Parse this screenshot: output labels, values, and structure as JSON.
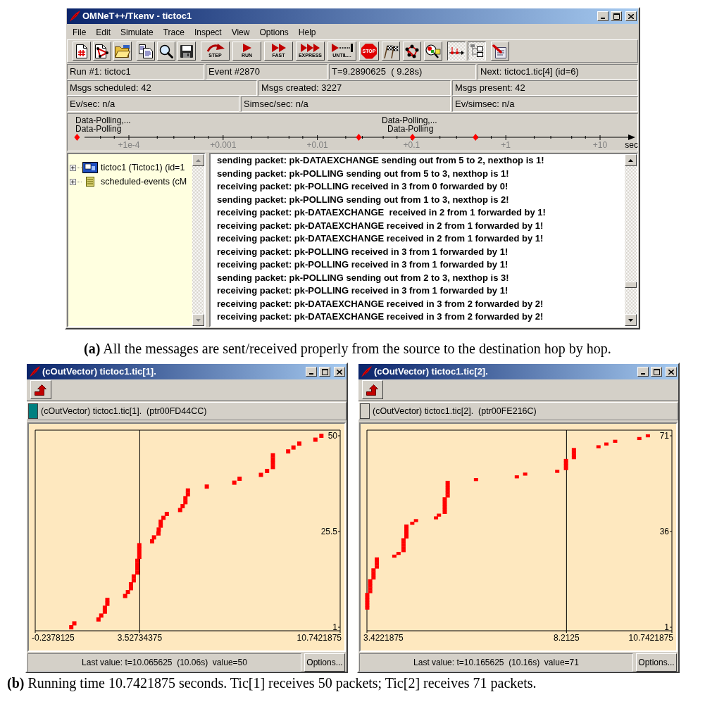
{
  "main_window": {
    "title": "OMNeT++/Tkenv - tictoc1",
    "menu": [
      "File",
      "Edit",
      "Simulate",
      "Trace",
      "Inspect",
      "View",
      "Options",
      "Help"
    ],
    "toolbar": [
      [
        {
          "kind": "new",
          "pressed": false
        },
        {
          "kind": "load",
          "pressed": false
        },
        {
          "kind": "open",
          "pressed": false
        }
      ],
      [
        {
          "kind": "copy",
          "pressed": false
        },
        {
          "kind": "find",
          "pressed": false
        },
        {
          "kind": "save",
          "pressed": false
        }
      ],
      [
        {
          "kind": "step",
          "label": "STEP",
          "pressed": false
        },
        {
          "kind": "run",
          "label": "RUN",
          "pressed": false
        },
        {
          "kind": "fast",
          "label": "FAST",
          "pressed": false
        },
        {
          "kind": "express",
          "label": "EXPRESS",
          "pressed": false
        },
        {
          "kind": "until",
          "label": "UNTIL...",
          "pressed": false
        },
        {
          "kind": "stop",
          "label": "STOP",
          "pressed": false
        },
        {
          "kind": "finish",
          "pressed": false
        },
        {
          "kind": "network",
          "pressed": false
        },
        {
          "kind": "inspect",
          "pressed": false
        }
      ],
      [
        {
          "kind": "timeline",
          "pressed": true
        },
        {
          "kind": "tree",
          "pressed": true
        }
      ],
      [
        {
          "kind": "options",
          "pressed": false
        }
      ]
    ],
    "status_rows": [
      [
        "Run #1: tictoc1",
        "Event #2870",
        "T=9.2890625  ( 9.28s)",
        "Next: tictoc1.tic[4] (id=6)"
      ],
      [
        "Msgs scheduled: 42",
        "Msgs created: 3227",
        "Msgs present: 42"
      ],
      [
        "Ev/sec: n/a",
        "Simsec/sec: n/a",
        "Ev/simsec: n/a"
      ]
    ],
    "timeline": {
      "labels": [
        "Data-Polling,...",
        "Data-Polling",
        "Data-Polling,...",
        "Data-Polling"
      ],
      "ticks": [
        "+1e-4",
        "+0.001",
        "+0.01",
        "+0.1",
        "+1",
        "+10"
      ],
      "unit": "sec"
    },
    "object_tree": [
      {
        "kind": "module",
        "label": "tictoc1 (Tictoc1) (id=1",
        "expanded": false
      },
      {
        "kind": "queue",
        "label": "scheduled-events (cM",
        "expanded": false
      }
    ],
    "log": [
      "sending packet: pk-DATAEXCHANGE sending out from 5 to 2, nexthop is 1!",
      "sending packet: pk-POLLING sending out from 5 to 3, nexthop is 1!",
      "receiving packet: pk-POLLING received in 3 from 0 forwarded by 0!",
      "sending packet: pk-POLLING sending out from 1 to 3, nexthop is 2!",
      "receiving packet: pk-DATAEXCHANGE  received in 2 from 1 forwarded by 1!",
      "receiving packet: pk-DATAEXCHANGE received in 2 from 1 forwarded by 1!",
      "receiving packet: pk-DATAEXCHANGE received in 2 from 1 forwarded by 1!",
      "receiving packet: pk-POLLING received in 3 from 1 forwarded by 1!",
      "receiving packet: pk-POLLING received in 3 from 1 forwarded by 1!",
      "sending packet: pk-POLLING sending out from 2 to 3, nexthop is 3!",
      "receiving packet: pk-POLLING received in 3 from 1 forwarded by 1!",
      "receiving packet: pk-DATAEXCHANGE received in 3 from 2 forwarded by 2!",
      "receiving packet: pk-DATAEXCHANGE received in 3 from 2 forwarded by 2!"
    ]
  },
  "caption_a": "**(a)** All the messages are sent/received properly from the source to the destination hop by hop.",
  "vector_windows": [
    {
      "title": "(cOutVector) tictoc1.tic[1].",
      "color": "#008080",
      "info": "(cOutVector) tictoc1.tic[1].  (ptr00FD44CC)",
      "chart_data": {
        "type": "scatter",
        "xlim": [
          -0.2378125,
          10.7421875
        ],
        "ylim": [
          0.1,
          51.44
        ],
        "xticks": [
          -0.2378125,
          3.52734375,
          10.7421875
        ],
        "yticks": [
          1,
          25.5,
          50
        ],
        "x": [
          1.06,
          1.17,
          2.04,
          2.14,
          2.27,
          2.27,
          2.36,
          2.36,
          3.0,
          3.1,
          3.21,
          3.21,
          3.31,
          3.31,
          3.44,
          3.44,
          3.44,
          3.44,
          3.51,
          3.51,
          3.51,
          3.51,
          3.97,
          4.04,
          4.2,
          4.21,
          4.28,
          4.28,
          4.38,
          4.5,
          4.98,
          5.07,
          5.17,
          5.17,
          5.26,
          5.26,
          5.94,
          6.93,
          7.12,
          7.89,
          8.11,
          8.32,
          8.32,
          8.32,
          8.32,
          8.87,
          9.06,
          9.27,
          9.85,
          10.065625
        ],
        "series": [
          {
            "color": "#ff0000",
            "values": [
              1,
              2,
              3,
              4,
              5,
              6,
              7,
              8,
              9,
              10,
              11,
              12,
              13,
              14,
              15,
              16,
              17,
              18,
              19,
              20,
              21,
              22,
              23,
              24,
              25,
              26,
              27,
              28,
              29,
              30,
              31,
              32,
              33,
              34,
              35,
              36,
              37,
              38,
              39,
              40,
              41,
              42,
              43,
              44,
              45,
              46,
              47,
              48,
              49,
              50
            ]
          }
        ]
      },
      "last_value": "Last value: t=10.065625  (10.06s)  value=50",
      "options_button": "Options..."
    },
    {
      "title": "(cOutVector) tictoc1.tic[2].",
      "color": "#d4d0c8",
      "info": "(cOutVector) tictoc1.tic[2].  (ptr00FE216C)",
      "chart_data": {
        "type": "scatter",
        "xlim": [
          3.4221875,
          10.7421875
        ],
        "ylim": [
          -0.29,
          73.07
        ],
        "xticks": [
          3.4221875,
          8.2125,
          10.7421875
        ],
        "yticks": [
          1,
          36,
          71
        ],
        "x": [
          3.43,
          3.43,
          3.43,
          3.43,
          3.43,
          3.43,
          3.5,
          3.5,
          3.5,
          3.5,
          3.5,
          3.58,
          3.58,
          3.58,
          3.58,
          3.66,
          3.66,
          3.66,
          3.66,
          4.08,
          4.18,
          4.3,
          4.3,
          4.3,
          4.3,
          4.3,
          4.37,
          4.37,
          4.37,
          4.37,
          4.37,
          4.51,
          4.6,
          5.08,
          5.15,
          5.29,
          5.29,
          5.29,
          5.29,
          5.29,
          5.29,
          5.36,
          5.36,
          5.36,
          5.36,
          5.36,
          5.36,
          6.04,
          7.02,
          7.22,
          7.99,
          8.2,
          8.2,
          8.2,
          8.2,
          8.39,
          8.39,
          8.39,
          8.39,
          8.98,
          9.17,
          9.38,
          9.96,
          10.165625
        ],
        "series": [
          {
            "color": "#ff0000",
            "values": [
              8,
              9,
              10,
              11,
              12,
              13,
              14,
              15,
              16,
              17,
              18,
              19,
              20,
              21,
              22,
              23,
              24,
              25,
              26,
              27,
              28,
              29,
              30,
              31,
              32,
              33,
              34,
              35,
              36,
              37,
              38,
              39,
              40,
              41,
              42,
              43,
              44,
              45,
              46,
              47,
              48,
              49,
              50,
              51,
              52,
              53,
              54,
              55,
              56,
              57,
              58,
              59,
              60,
              61,
              62,
              63,
              64,
              65,
              66,
              67,
              68,
              69,
              70,
              71
            ]
          }
        ]
      },
      "last_value": "Last value: t=10.165625  (10.16s)  value=71",
      "options_button": "Options..."
    }
  ],
  "caption_b": "**(b)** Running time 10.7421875 seconds. Tic[1] receives 50 packets; Tic[2] receives 71 packets."
}
